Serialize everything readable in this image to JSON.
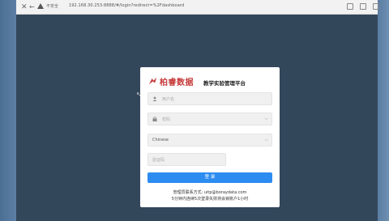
{
  "browser": {
    "back_label": "←",
    "close_label": "✕",
    "security_label": "不安全",
    "url": "192.168.30.253:8888/#/login?redirect=%2Fdashboard"
  },
  "login": {
    "brand": "柏睿数据",
    "platform_title": "教学实验管理平台",
    "username_placeholder": "用户名",
    "password_placeholder": "密码",
    "language_value": "Chinese",
    "captcha_placeholder": "验证码",
    "login_button": "登 录",
    "contact_text": "管理员联系方式: uitp@boraydata.com",
    "lock_notice": "5分钟内连续5次登录失败将会锁账户1小时"
  },
  "colors": {
    "primary": "#2d8cf0",
    "brand_red": "#c63a3a",
    "background": "#33475b"
  }
}
